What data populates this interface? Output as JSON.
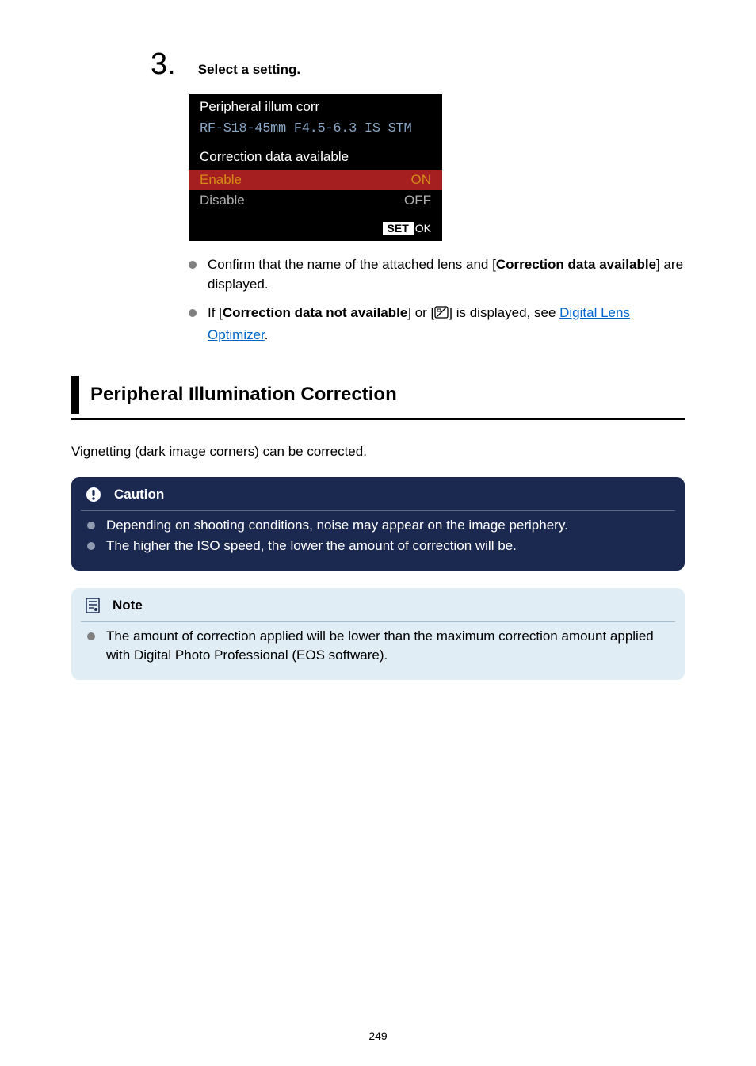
{
  "step": {
    "number": "3.",
    "title": "Select a setting."
  },
  "camera_screen": {
    "title": "Peripheral illum corr",
    "lens": "RF-S18-45mm F4.5-6.3 IS STM",
    "status": "Correction data available",
    "options": [
      {
        "label": "Enable",
        "value": "ON",
        "selected": true
      },
      {
        "label": "Disable",
        "value": "OFF",
        "selected": false
      }
    ],
    "set_label": "SET",
    "ok_label": "OK"
  },
  "bullets": {
    "b1_pre": "Confirm that the name of the attached lens and [",
    "b1_bold": "Correction data available",
    "b1_post": "] are displayed.",
    "b2_pre": "If [",
    "b2_bold": "Correction data not available",
    "b2_mid": "] or [",
    "b2_post": "] is displayed, see ",
    "b2_link": "Digital Lens Optimizer",
    "b2_end": "."
  },
  "section_heading": "Peripheral Illumination Correction",
  "body_text": "Vignetting (dark image corners) can be corrected.",
  "caution": {
    "title": "Caution",
    "items": [
      "Depending on shooting conditions, noise may appear on the image periphery.",
      "The higher the ISO speed, the lower the amount of correction will be."
    ]
  },
  "note": {
    "title": "Note",
    "items": [
      "The amount of correction applied will be lower than the maximum correction amount applied with Digital Photo Professional (EOS software)."
    ]
  },
  "page_number": "249"
}
